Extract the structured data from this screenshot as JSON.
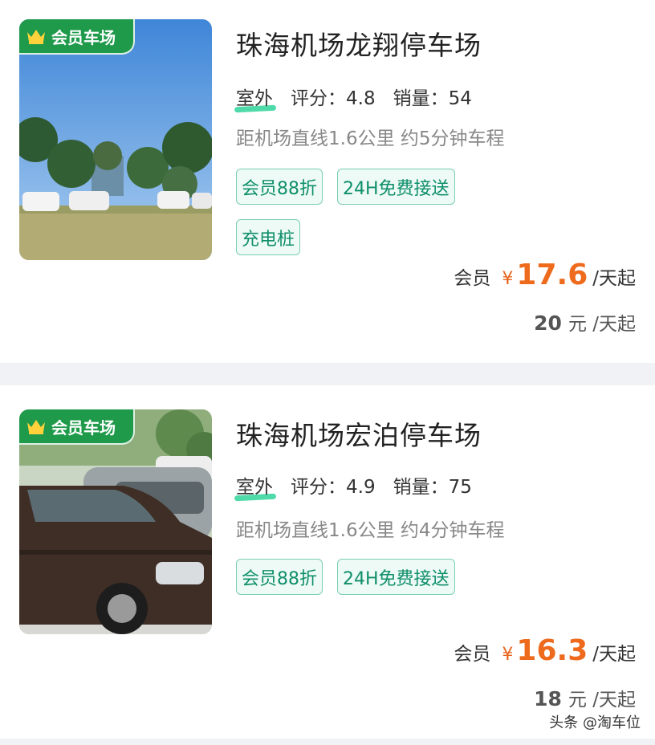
{
  "listings": [
    {
      "badge": "会员车场",
      "title": "珠海机场龙翔停车场",
      "type": "室外",
      "rating_label": "评分：",
      "rating": "4.8",
      "sales_label": "销量：",
      "sales": "54",
      "distance": "距机场直线1.6公里 约5分钟车程",
      "tags": [
        "会员88折",
        "24H免费接送",
        "充电桩"
      ],
      "member_label": "会员",
      "currency": "¥",
      "member_price": "17.6",
      "unit": "/天起",
      "original_price": "20",
      "original_unit": "元 /天起"
    },
    {
      "badge": "会员车场",
      "title": "珠海机场宏泊停车场",
      "type": "室外",
      "rating_label": "评分：",
      "rating": "4.9",
      "sales_label": "销量：",
      "sales": "75",
      "distance": "距机场直线1.6公里 约4分钟车程",
      "tags": [
        "会员88折",
        "24H免费接送"
      ],
      "member_label": "会员",
      "currency": "¥",
      "member_price": "16.3",
      "unit": "/天起",
      "original_price": "18",
      "original_unit": "元 /天起"
    }
  ],
  "watermark": "头条 @淘车位",
  "colors": {
    "accent_green": "#1e9a4a",
    "price_orange": "#ee6a1c",
    "tag_green": "#0f8f6a"
  }
}
